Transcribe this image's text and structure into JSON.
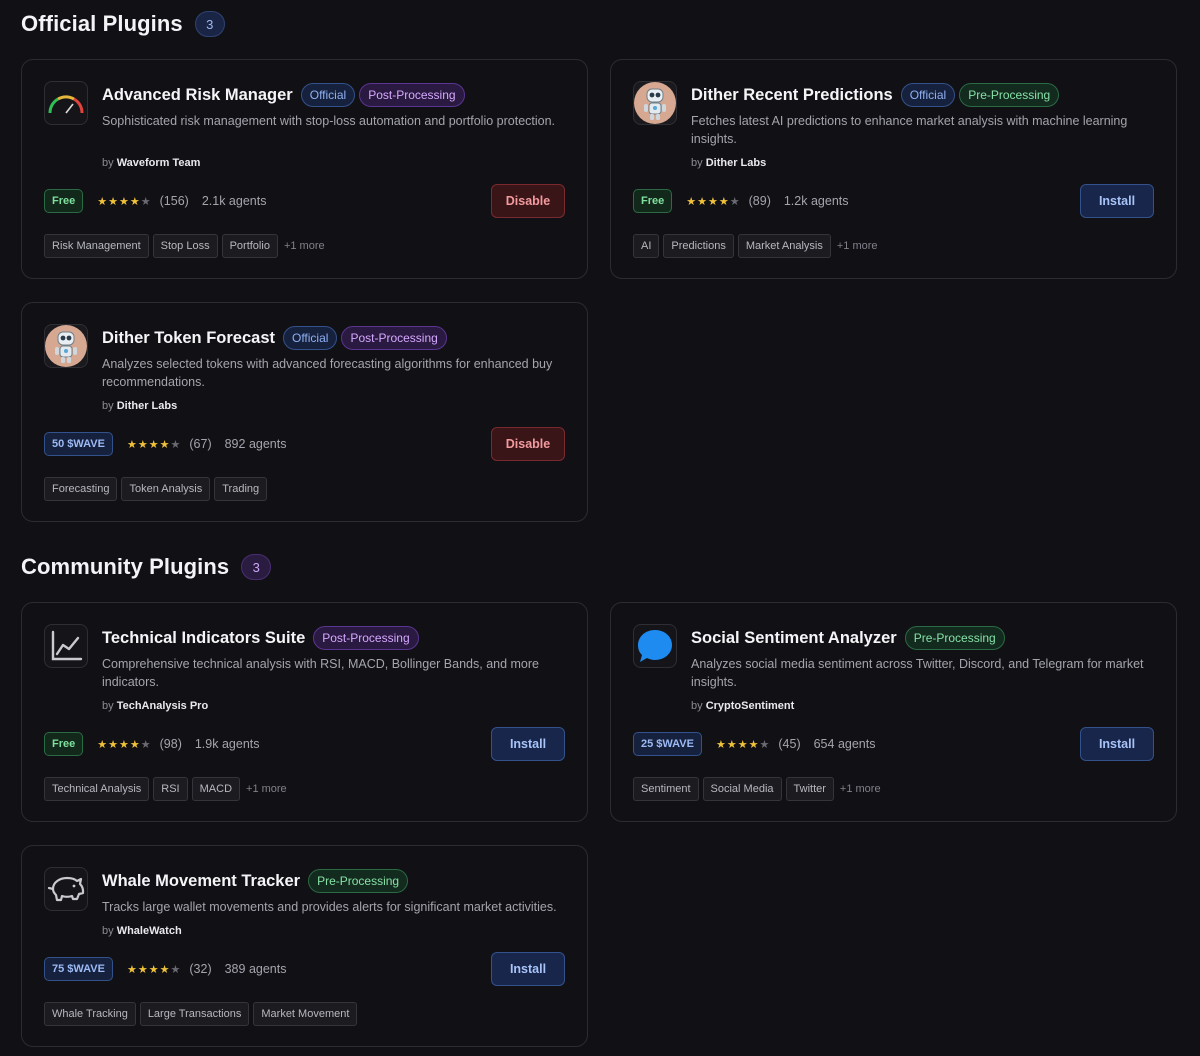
{
  "official": {
    "title": "Official Plugins",
    "count": "3",
    "cards": [
      {
        "title": "Advanced Risk Manager",
        "badges": [
          "Official",
          "Post-Processing"
        ],
        "description": "Sophisticated risk management with stop-loss automation and portfolio protection.",
        "by": "by",
        "author": "Waveform Team",
        "price": "Free",
        "rating": 4,
        "reviews": "(156)",
        "agents": "2.1k agents",
        "action": "Disable",
        "tags": [
          "Risk Management",
          "Stop Loss",
          "Portfolio"
        ],
        "more": "+1 more",
        "icon": "gauge-icon"
      },
      {
        "title": "Dither Recent Predictions",
        "badges": [
          "Official",
          "Pre-Processing"
        ],
        "description": "Fetches latest AI predictions to enhance market analysis with machine learning insights.",
        "by": "by",
        "author": "Dither Labs",
        "price": "Free",
        "rating": 4,
        "reviews": "(89)",
        "agents": "1.2k agents",
        "action": "Install",
        "tags": [
          "AI",
          "Predictions",
          "Market Analysis"
        ],
        "more": "+1 more",
        "icon": "robot-icon"
      },
      {
        "title": "Dither Token Forecast",
        "badges": [
          "Official",
          "Post-Processing"
        ],
        "description": "Analyzes selected tokens with advanced forecasting algorithms for enhanced buy recommendations.",
        "by": "by",
        "author": "Dither Labs",
        "price": "50 $WAVE",
        "rating": 4,
        "reviews": "(67)",
        "agents": "892 agents",
        "action": "Disable",
        "tags": [
          "Forecasting",
          "Token Analysis",
          "Trading"
        ],
        "more": "",
        "icon": "robot-icon"
      }
    ]
  },
  "community": {
    "title": "Community Plugins",
    "count": "3",
    "cards": [
      {
        "title": "Technical Indicators Suite",
        "badges": [
          "Post-Processing"
        ],
        "description": "Comprehensive technical analysis with RSI, MACD, Bollinger Bands, and more indicators.",
        "by": "by",
        "author": "TechAnalysis Pro",
        "price": "Free",
        "rating": 4,
        "reviews": "(98)",
        "agents": "1.9k agents",
        "action": "Install",
        "tags": [
          "Technical Analysis",
          "RSI",
          "MACD"
        ],
        "more": "+1 more",
        "icon": "line-chart-icon"
      },
      {
        "title": "Social Sentiment Analyzer",
        "badges": [
          "Pre-Processing"
        ],
        "description": "Analyzes social media sentiment across Twitter, Discord, and Telegram for market insights.",
        "by": "by",
        "author": "CryptoSentiment",
        "price": "25 $WAVE",
        "rating": 4,
        "reviews": "(45)",
        "agents": "654 agents",
        "action": "Install",
        "tags": [
          "Sentiment",
          "Social Media",
          "Twitter"
        ],
        "more": "+1 more",
        "icon": "chat-bubble-icon"
      },
      {
        "title": "Whale Movement Tracker",
        "badges": [
          "Pre-Processing"
        ],
        "description": "Tracks large wallet movements and provides alerts for significant market activities.",
        "by": "by",
        "author": "WhaleWatch",
        "price": "75 $WAVE",
        "rating": 4,
        "reviews": "(32)",
        "agents": "389 agents",
        "action": "Install",
        "tags": [
          "Whale Tracking",
          "Large Transactions",
          "Market Movement"
        ],
        "more": "",
        "icon": "piggy-bank-icon"
      }
    ]
  },
  "colors": {
    "background": "#111115",
    "official_badge": "#8fb0f2",
    "post_processing": "#d6a9ff",
    "pre_processing": "#86e0a6",
    "free_price": "#7fe09d",
    "disable": "#f29a9e",
    "install": "#a8c3f8",
    "star": "#f0c23a"
  }
}
